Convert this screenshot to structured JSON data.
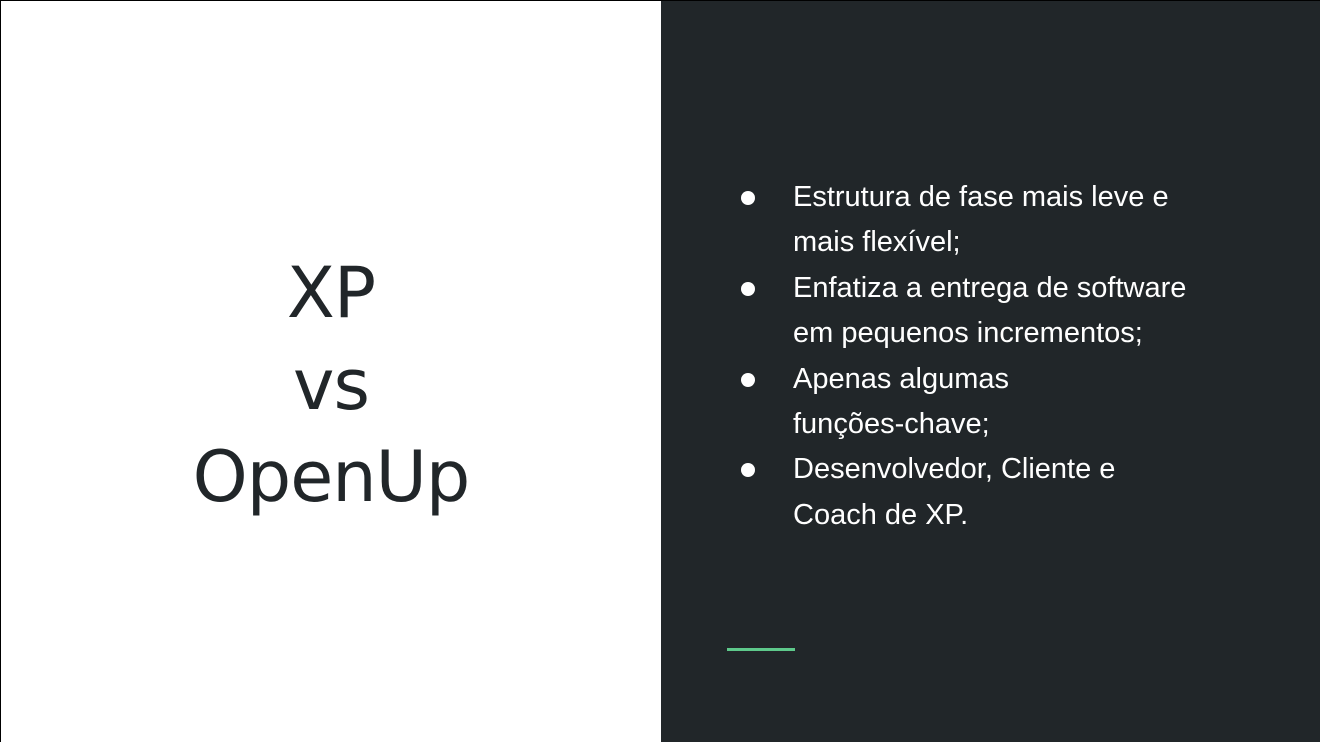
{
  "slide": {
    "title_lines": [
      "XP",
      "vs",
      "OpenUp"
    ],
    "bullets": [
      [
        "Estrutura de fase mais leve e",
        "mais flexível;"
      ],
      [
        "Enfatiza a entrega de software",
        "em pequenos incrementos;"
      ],
      [
        "Apenas algumas",
        "funções-chave;"
      ],
      [
        "Desenvolvedor, Cliente e",
        "Coach de XP."
      ]
    ],
    "colors": {
      "dark_panel": "#212629",
      "title_text": "#212629",
      "bullet_text": "#ffffff",
      "accent": "#5ec98b"
    }
  }
}
